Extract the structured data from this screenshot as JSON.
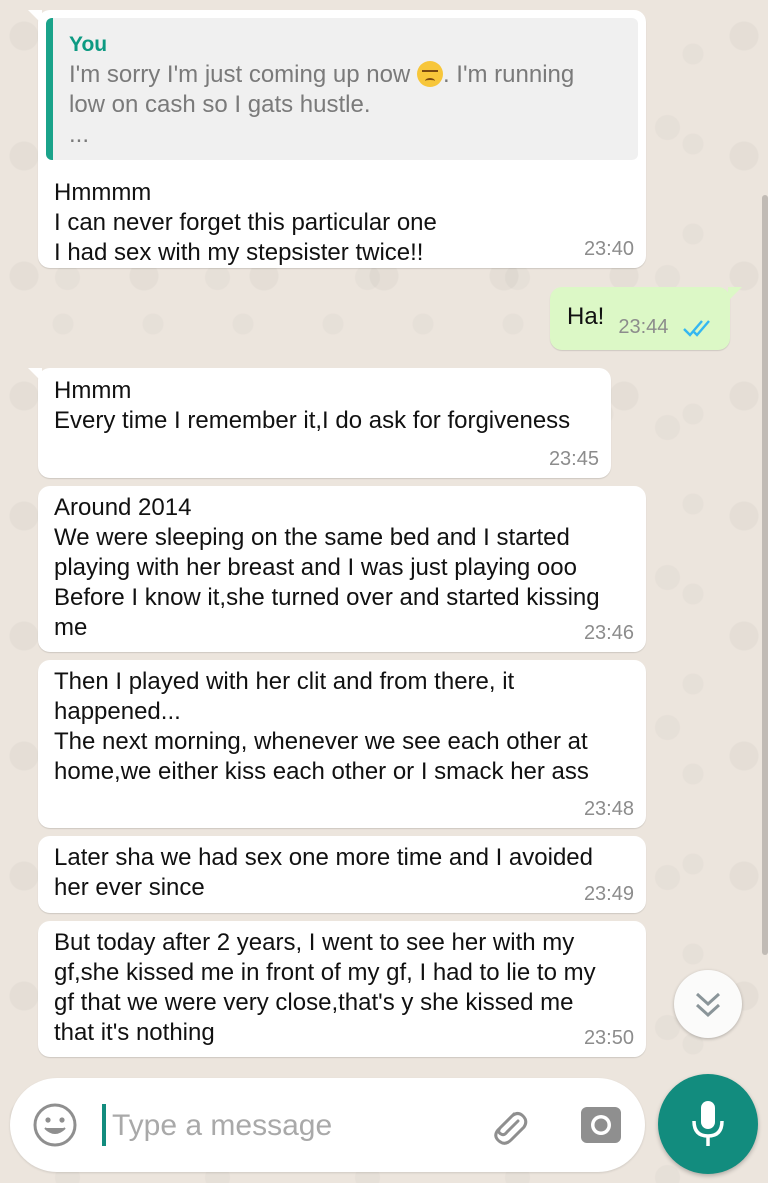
{
  "messages": [
    {
      "quote": {
        "sender": "You",
        "text_before_emoji": "I'm sorry I'm just coming up now ",
        "emoji": "pensive-face-emoji",
        "text_after_emoji": ". I'm running\nlow on cash so I gats hustle.\n..."
      },
      "text": "Hmmmm\nI can never forget this particular one\nI had sex with my stepsister twice!!",
      "time": "23:40"
    },
    {
      "text": "Ha!",
      "time": "23:44",
      "status": "double-tick-read-icon"
    },
    {
      "text": "Hmmm\nEvery time I remember it,I do ask for forgiveness",
      "time": "23:45"
    },
    {
      "text": "Around 2014\nWe were sleeping on the same bed and I started\nplaying with her breast and I was just playing ooo\nBefore I know it,she turned over and started kissing\nme",
      "time": "23:46"
    },
    {
      "text": "Then I played with her clit and from there, it\nhappened...\nThe next morning, whenever we see each other at\nhome,we either kiss each other or I smack her ass",
      "time": "23:48"
    },
    {
      "text": "Later sha we had sex one more time and I avoided\nher ever since",
      "time": "23:49"
    },
    {
      "text": "But today after 2 years, I went to see her with my\ngf,she kissed me in front of my gf, I had to lie to my\ngf that we were very close,that's y she kissed me\nthat it's nothing",
      "time": "23:50"
    }
  ],
  "input": {
    "placeholder": "Type a message",
    "value": ""
  },
  "icons": {
    "emoji": "smiley-icon",
    "attach": "paperclip-icon",
    "camera": "camera-icon",
    "mic": "microphone-icon",
    "scroll_down": "chevron-double-down-icon"
  },
  "colors": {
    "incoming_bubble": "#ffffff",
    "outgoing_bubble": "#dcf8c6",
    "accent": "#128c7e",
    "read_ticks": "#34b7f1",
    "wallpaper": "#ece5dd"
  }
}
